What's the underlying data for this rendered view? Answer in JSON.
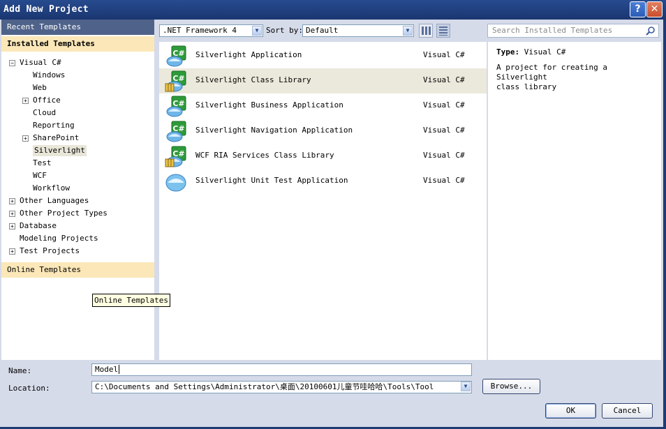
{
  "window": {
    "title": "Add New Project",
    "help_glyph": "?",
    "close_glyph": "✕"
  },
  "left": {
    "recent_templates": "Recent Templates",
    "installed_templates": "Installed Templates",
    "online_templates": "Online Templates",
    "tree": [
      {
        "label": "Visual C#",
        "expander": "⊟",
        "level": 0
      },
      {
        "label": "Windows",
        "expander": "",
        "level": 1
      },
      {
        "label": "Web",
        "expander": "",
        "level": 1
      },
      {
        "label": "Office",
        "expander": "⊞",
        "level": 1
      },
      {
        "label": "Cloud",
        "expander": "",
        "level": 1
      },
      {
        "label": "Reporting",
        "expander": "",
        "level": 1
      },
      {
        "label": "SharePoint",
        "expander": "⊞",
        "level": 1
      },
      {
        "label": "Silverlight",
        "expander": "",
        "level": 1,
        "selected": true
      },
      {
        "label": "Test",
        "expander": "",
        "level": 1
      },
      {
        "label": "WCF",
        "expander": "",
        "level": 1
      },
      {
        "label": "Workflow",
        "expander": "",
        "level": 1
      },
      {
        "label": "Other Languages",
        "expander": "⊞",
        "level": 0
      },
      {
        "label": "Other Project Types",
        "expander": "⊞",
        "level": 0
      },
      {
        "label": "Database",
        "expander": "⊞",
        "level": 0
      },
      {
        "label": "Modeling Projects",
        "expander": "",
        "level": 0
      },
      {
        "label": "Test Projects",
        "expander": "⊞",
        "level": 0
      }
    ],
    "tooltip": "Online Templates"
  },
  "toolbar": {
    "framework": ".NET Framework 4",
    "sort_by_label": "Sort by:",
    "sort_value": "Default",
    "search_placeholder": "Search Installed Templates"
  },
  "templates": [
    {
      "name": "Silverlight Application",
      "language": "Visual C#",
      "icon": "silverlight-csharp-icon"
    },
    {
      "name": "Silverlight Class Library",
      "language": "Visual C#",
      "icon": "silverlight-class-library-icon",
      "selected": true
    },
    {
      "name": "Silverlight Business Application",
      "language": "Visual C#",
      "icon": "silverlight-csharp-icon"
    },
    {
      "name": "Silverlight Navigation Application",
      "language": "Visual C#",
      "icon": "silverlight-csharp-icon"
    },
    {
      "name": "WCF RIA Services Class Library",
      "language": "Visual C#",
      "icon": "silverlight-class-library-icon"
    },
    {
      "name": "Silverlight Unit Test Application",
      "language": "Visual C#",
      "icon": "silverlight-icon"
    }
  ],
  "details": {
    "type_label": "Type:",
    "type_value": "Visual C#",
    "description_line1": "A project for creating a Silverlight",
    "description_line2": "class library"
  },
  "form": {
    "name_label": "Name:",
    "name_value": "Model",
    "location_label": "Location:",
    "location_value": "C:\\Documents and Settings\\Administrator\\桌面\\20100601儿童节哇哈哈\\Tools\\Tool",
    "browse_label": "Browse...",
    "ok_label": "OK",
    "cancel_label": "Cancel"
  }
}
